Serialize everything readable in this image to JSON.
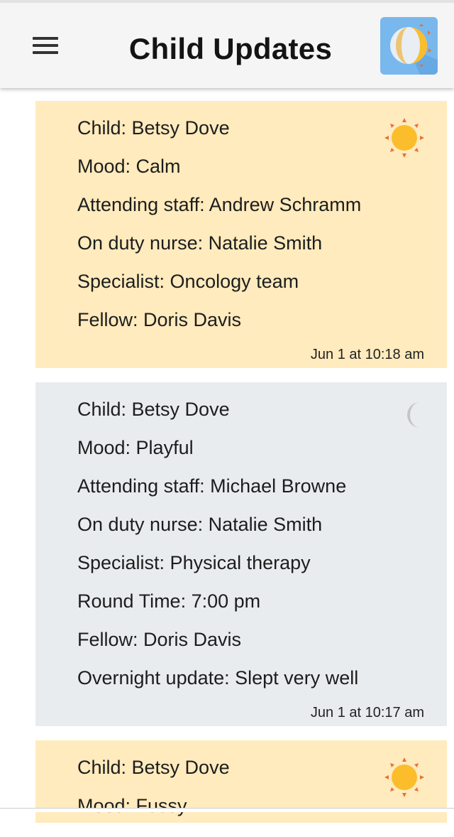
{
  "app": {
    "title": "Child Updates"
  },
  "icons": {
    "menu": "hamburger-menu-icon",
    "toggle": "day-night-toggle-icon",
    "day": "sun-icon",
    "night": "moon-icon"
  },
  "colors": {
    "day_card": "#ffebbd",
    "night_card": "#e9ecef",
    "sun": "#fbbd2c",
    "sun_rays": "#e8703a",
    "moon": "#c4c4c4"
  },
  "updates": [
    {
      "period": "day",
      "lines": [
        "Child: Betsy Dove",
        "Mood: Calm",
        "Attending staff: Andrew Schramm",
        "On duty nurse: Natalie Smith",
        "Specialist: Oncology team",
        "Fellow: Doris Davis"
      ],
      "timestamp": "Jun 1 at 10:18 am"
    },
    {
      "period": "night",
      "lines": [
        "Child: Betsy Dove",
        "Mood: Playful",
        "Attending staff: Michael Browne",
        "On duty nurse: Natalie Smith",
        "Specialist: Physical therapy",
        "Round Time: 7:00 pm",
        "Fellow: Doris Davis",
        "Overnight update: Slept very well"
      ],
      "timestamp": "Jun 1 at 10:17 am"
    },
    {
      "period": "day",
      "lines": [
        "Child: Betsy Dove",
        "Mood: Fussy"
      ],
      "timestamp": ""
    }
  ]
}
